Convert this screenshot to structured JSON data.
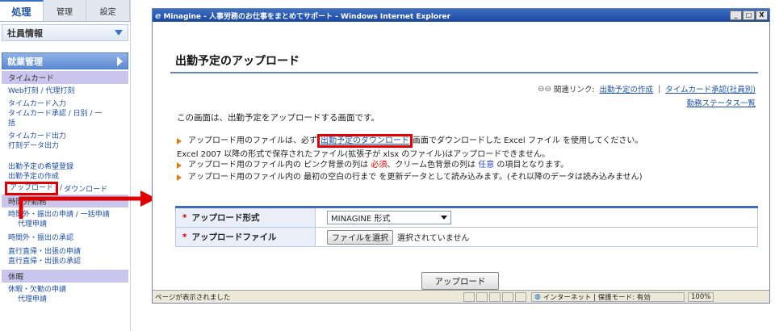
{
  "sidebar": {
    "tabs": [
      "処理",
      "管理",
      "設定"
    ],
    "section1": "社員情報",
    "section2": "就業管理",
    "cat_timecard": "タイムカード",
    "timecard_links": [
      "Web打刻 / 代理打刻",
      "タイムカード入力",
      "タイムカード承認 / 日別 / 一",
      "括",
      "タイムカード出力",
      "打刻データ出力"
    ],
    "plan_links": [
      "出勤予定の希望登録",
      "出勤予定の作成"
    ],
    "upload_label": "アップロード",
    "upload_sep": "/",
    "download_label": "ダウンロード",
    "cat_overtime": "時間外勤務",
    "overtime_links": [
      "時間外・振出の申請 / 一括申請",
      "代理申請",
      "時間外・振出の承認",
      "直行直帰・出張の申請",
      "直行直帰・出張の承認"
    ],
    "cat_leave": "休暇",
    "leave_links": [
      "休暇・欠勤の申請",
      "代理申請"
    ]
  },
  "window": {
    "title": "Minagine - 人事労務のお仕事をまとめてサポート - Windows Internet Explorer",
    "controls": [
      "_",
      "□",
      "X"
    ]
  },
  "page": {
    "title": "出勤予定のアップロード",
    "related_label": "関連リンク:",
    "related_links": [
      "出勤予定の作成",
      "タイムカード承認(社員別)"
    ],
    "related_sep": "|",
    "related_link3": "勤務ステータス一覧",
    "intro": "この画面は、出勤予定をアップロードする画面です。",
    "note1_a": "アップロード用のファイルは、必ず",
    "note1_link": "出勤予定のダウンロード",
    "note1_b": "画面でダウンロードした Excel ファイル を使用してください。",
    "note1_c": "Excel 2007 以降の形式で保存されたファイル(拡張子が xlsx のファイル)はアップロードできません。",
    "note2_a": "アップロード用のファイル内の ピンク背景の列は ",
    "note2_req": "必須",
    "note2_b": "、クリーム色背景の列は ",
    "note2_opt": "任意",
    "note2_c": " の項目となります。",
    "note3": "アップロード用のファイル内の 最初の空白の行まで を更新データとして読み込みます。(それ以降のデータは読み込みません)",
    "form": {
      "star": "*",
      "format_label": "アップロード形式",
      "format_value": "MINAGINE 形式",
      "file_label": "アップロードファイル",
      "file_button": "ファイルを選択",
      "file_status": "選択されていません"
    },
    "submit": "アップロード"
  },
  "statusbar": {
    "text": "ページが表示されました",
    "zone": "インターネット | 保護モード: 有効",
    "zoom": "100%"
  }
}
